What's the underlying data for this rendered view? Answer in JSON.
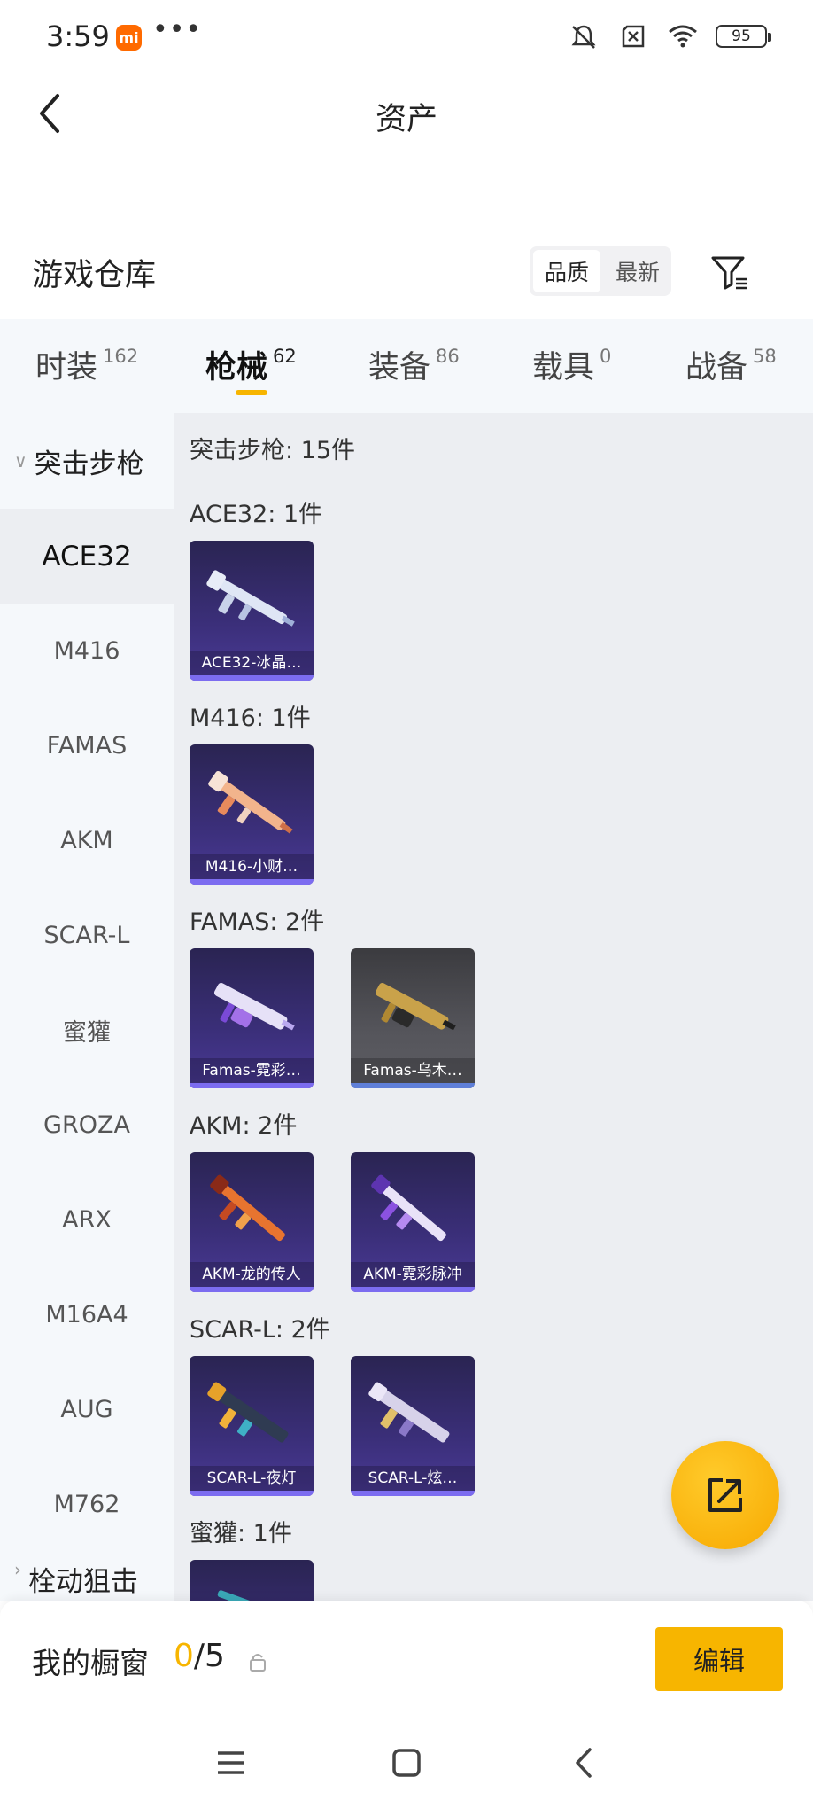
{
  "status": {
    "time": "3:59",
    "mi_badge": "mi",
    "dots": "•••",
    "battery": "95"
  },
  "header": {
    "title": "资产"
  },
  "warehouse": {
    "title": "游戏仓库",
    "sort_options": [
      "品质",
      "最新"
    ],
    "active_sort": "品质"
  },
  "tabs": [
    {
      "label": "时装",
      "count": "162"
    },
    {
      "label": "枪械",
      "count": "62"
    },
    {
      "label": "装备",
      "count": "86"
    },
    {
      "label": "载具",
      "count": "0"
    },
    {
      "label": "战备",
      "count": "58"
    }
  ],
  "active_tab": "枪械",
  "sidebar": {
    "group": "突击步枪",
    "items": [
      "ACE32",
      "M416",
      "FAMAS",
      "AKM",
      "SCAR-L",
      "蜜獾",
      "GROZA",
      "ARX",
      "M16A4",
      "AUG",
      "M762"
    ],
    "next_group": "栓动狙击",
    "active_item": "ACE32"
  },
  "content": {
    "summary": "突击步枪: 15件",
    "sections": [
      {
        "title": "ACE32: 1件",
        "cards": [
          "ACE32-冰晶…"
        ]
      },
      {
        "title": "M416: 1件",
        "cards": [
          "M416-小财…"
        ]
      },
      {
        "title": "FAMAS: 2件",
        "cards": [
          "Famas-霓彩…",
          "Famas-乌木…"
        ]
      },
      {
        "title": "AKM: 2件",
        "cards": [
          "AKM-龙的传人",
          "AKM-霓彩脉冲"
        ]
      },
      {
        "title": "SCAR-L: 2件",
        "cards": [
          "SCAR-L-夜灯",
          "SCAR-L-炫…"
        ]
      },
      {
        "title": "蜜獾: 1件",
        "cards": []
      }
    ]
  },
  "bottom": {
    "window_label": "我的橱窗",
    "count_current": "0",
    "count_total": "/5",
    "edit_label": "编辑"
  },
  "colors": {
    "accent": "#f7b500",
    "card_purple": "#3b2f7a",
    "card_grey": "#55555b"
  },
  "icons": [
    "back-arrow-icon",
    "filter-icon",
    "share-icon",
    "lock-icon",
    "menu-icon",
    "home-icon",
    "back-icon"
  ]
}
